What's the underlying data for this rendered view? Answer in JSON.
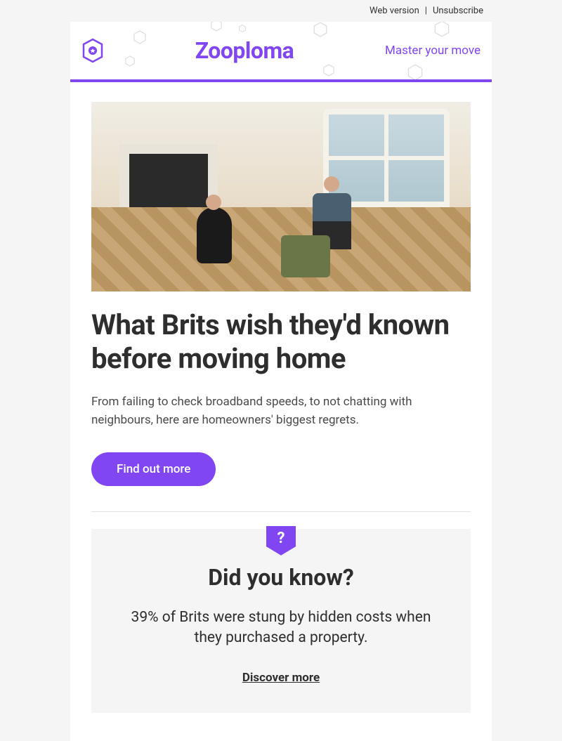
{
  "topbar": {
    "web_version": "Web version",
    "separator": "|",
    "unsubscribe": "Unsubscribe"
  },
  "header": {
    "brand": "Zooploma",
    "tagline": "Master your move"
  },
  "article": {
    "headline": "What Brits wish they'd known before moving home",
    "body": "From failing to check broadband speeds, to not chatting with neighbours, here are homeowners' biggest regrets.",
    "cta": "Find out more"
  },
  "fact": {
    "badge_icon": "?",
    "title": "Did you know?",
    "text": "39% of Brits were stung by hidden costs when they purchased a property.",
    "link": "Discover more"
  }
}
